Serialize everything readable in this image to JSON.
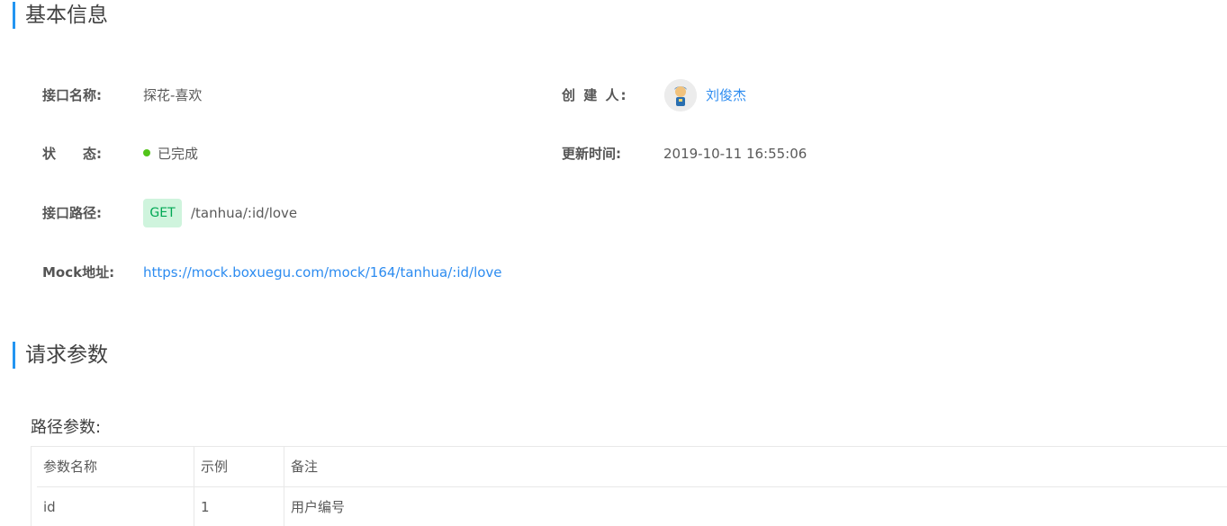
{
  "basic": {
    "title": "基本信息",
    "name_label": "接口名称:",
    "name_value": "探花-喜欢",
    "creator_label": "创 建 人:",
    "creator_name": "刘俊杰",
    "status_label": "状　　态:",
    "status_value": "已完成",
    "updated_label": "更新时间:",
    "updated_value": "2019-10-11 16:55:06",
    "path_label": "接口路径:",
    "method": "GET",
    "path_value": "/tanhua/:id/love",
    "mock_label": "Mock地址:",
    "mock_url": "https://mock.boxuegu.com/mock/164/tanhua/:id/love"
  },
  "request": {
    "title": "请求参数",
    "path_params_label": "路径参数:",
    "table": {
      "headers": [
        "参数名称",
        "示例",
        "备注"
      ],
      "rows": [
        [
          "id",
          "1",
          "用户编号"
        ]
      ]
    }
  },
  "colors": {
    "accent": "#2395f1",
    "link": "#2d8cf0",
    "status_done": "#52c41a",
    "get_bg": "#cff4dd",
    "get_text": "#00a854"
  }
}
